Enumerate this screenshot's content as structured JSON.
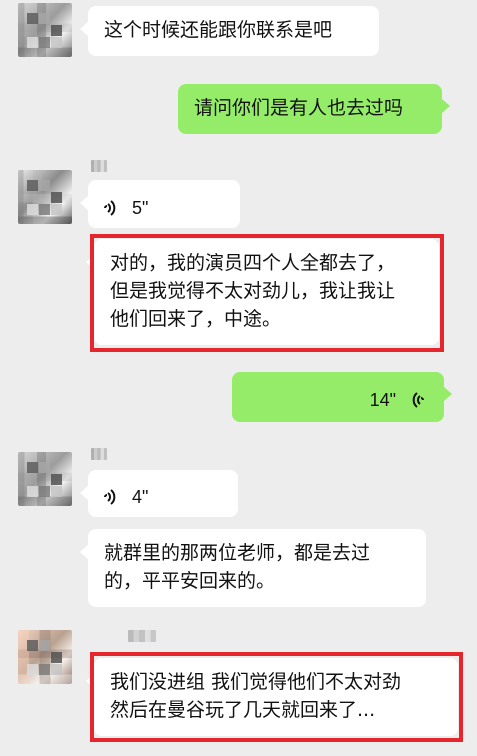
{
  "messages": [
    {
      "id": 1,
      "side": "left",
      "type": "text",
      "text": "这个时候还能跟你联系是吧"
    },
    {
      "id": 2,
      "side": "right",
      "type": "text",
      "text": "请问你们是有人也去过吗"
    },
    {
      "id": 3,
      "side": "left",
      "type": "voice",
      "duration": "5\""
    },
    {
      "id": 4,
      "side": "left",
      "type": "text",
      "text": "对的，我的演员四个人全都去了，\n但是我觉得不太对劲儿，我让我让\n他们回来了，中途。",
      "highlighted": true
    },
    {
      "id": 5,
      "side": "right",
      "type": "voice",
      "duration": "14\""
    },
    {
      "id": 6,
      "side": "left",
      "type": "voice",
      "duration": "4\""
    },
    {
      "id": 7,
      "side": "left",
      "type": "text",
      "text": "就群里的那两位老师，都是去过\n的，平平安回来的。"
    },
    {
      "id": 8,
      "side": "left",
      "type": "text",
      "text": "我们没进组 我们觉得他们不太对劲\n然后在曼谷玩了几天就回来了...",
      "highlighted": true
    }
  ],
  "colors": {
    "background": "#ededed",
    "incoming_bubble": "#ffffff",
    "outgoing_bubble": "#95ec69",
    "highlight_border": "#e5262d"
  },
  "icons": {
    "incoming_voice": "sound-wave-icon",
    "outgoing_voice": "sound-wave-icon"
  }
}
